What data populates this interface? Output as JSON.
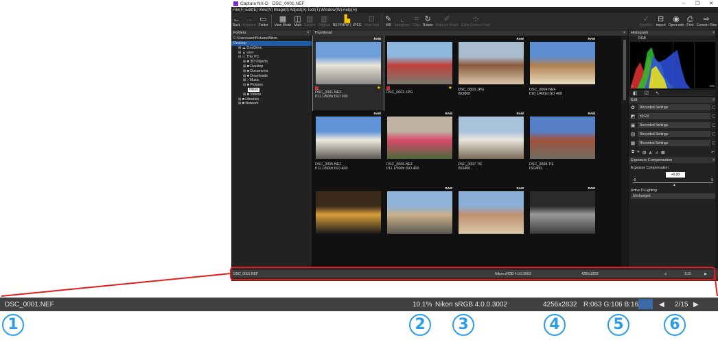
{
  "window": {
    "app_name": "Capture NX-D",
    "file_title": "DSC_0001.NEF",
    "controls": [
      "–",
      "❐",
      "✕"
    ]
  },
  "menu": [
    "File(F)",
    "Edit(E)",
    "View(V)",
    "Image(I)",
    "Adjust(A)",
    "Tool(T)",
    "Window(W)",
    "Help(H)"
  ],
  "toolbar": [
    {
      "label": "Back",
      "icon": "←",
      "name": "back"
    },
    {
      "label": "Forward",
      "icon": "→",
      "name": "forward",
      "dim": true
    },
    {
      "label": "Folder",
      "icon": "▭",
      "name": "folder"
    },
    {
      "sep": true
    },
    {
      "label": "View Mode",
      "icon": "▦",
      "name": "view-mode"
    },
    {
      "label": "Multi",
      "icon": "◫",
      "name": "multi"
    },
    {
      "label": "Current",
      "icon": "▥",
      "name": "current",
      "dim": true
    },
    {
      "label": "Original",
      "icon": "▥",
      "name": "original",
      "dim": true
    },
    {
      "label": "NEF/NRW + JPEG",
      "icon": "▙",
      "name": "nef-jpeg",
      "hl": true
    },
    {
      "label": "View Tool",
      "icon": "⊡",
      "name": "view-tool",
      "dim": true
    },
    {
      "sep": true
    },
    {
      "label": "WB",
      "icon": "✎",
      "name": "wb"
    },
    {
      "label": "Straighten",
      "icon": "⌞",
      "name": "straighten",
      "dim": true
    },
    {
      "label": "Crop",
      "icon": "⌗",
      "name": "crop",
      "dim": true
    },
    {
      "label": "Rotate",
      "icon": "↻",
      "name": "rotate"
    },
    {
      "label": "Retouch Brush",
      "icon": "✐",
      "name": "retouch-brush",
      "dim": true
    },
    {
      "label": "Color Control Point",
      "icon": "⊹",
      "name": "color-control-point",
      "dim": true
    },
    {
      "spacer": true
    },
    {
      "label": "ViewNX-i",
      "icon": "✓",
      "name": "viewnx-i",
      "dim": true
    },
    {
      "label": "Import",
      "icon": "⊟",
      "name": "import"
    },
    {
      "label": "Open with",
      "icon": "◉",
      "name": "open-with"
    },
    {
      "label": "Print",
      "icon": "⎙",
      "name": "print"
    },
    {
      "label": "Convert Files",
      "icon": "⇨",
      "name": "convert-files"
    }
  ],
  "folders": {
    "header": "Folders",
    "path": "C:\\Users\\user\\Pictures\\Nikon",
    "tree": [
      {
        "label": "Desktop",
        "indent": 0,
        "sel": true
      },
      {
        "label": "⊞ ☁ OneDrive",
        "indent": 1
      },
      {
        "label": "⊞ ▲ user",
        "indent": 1
      },
      {
        "label": "⊟ ▭ This PC",
        "indent": 1
      },
      {
        "label": "⊞ ■ 3D Objects",
        "indent": 2
      },
      {
        "label": "⊞ ■ Desktop",
        "indent": 2
      },
      {
        "label": "⊞ ■ Documents",
        "indent": 2
      },
      {
        "label": "⊞ ■ Downloads",
        "indent": 2
      },
      {
        "label": "⊞ ♪ Music",
        "indent": 2
      },
      {
        "label": "⊟ ■ Pictures",
        "indent": 2
      },
      {
        "label": "Nikon",
        "indent": 3,
        "nk": true
      },
      {
        "label": "⊞ ■ Videos",
        "indent": 2
      },
      {
        "label": "⊞ ■ Libraries",
        "indent": 1
      },
      {
        "label": "⊞ ■ Network",
        "indent": 1
      }
    ]
  },
  "thumbnails": {
    "header": "Thumbnail",
    "items": [
      {
        "line1": "DSC_0001.NEF",
        "line2": "f/11 1/500s ISO 200",
        "raw": true,
        "flag": true,
        "star": true,
        "sel": true,
        "colors": [
          "#6f9fd8",
          "#e8e3d8",
          "#8a8a86"
        ]
      },
      {
        "line1": "DSC_0002.JPG",
        "line2": "",
        "flag": true,
        "star": true,
        "colors": [
          "#8fb6dc",
          "#c0403a",
          "#7a7a70"
        ]
      },
      {
        "line1": "DSC_0003.JPG",
        "line2": "ISO800",
        "raw": true,
        "colors": [
          "#a9bccd",
          "#8a5a3e",
          "#d9c9a9"
        ]
      },
      {
        "line1": "DSC_0004.NEF",
        "line2": "f/10 1/400s ISO 400",
        "raw": true,
        "colors": [
          "#5d8fd0",
          "#b08050",
          "#e8dcc0"
        ]
      },
      {
        "line1": "DSC_0005.NEF",
        "line2": "f/11 1/500s ISO 400",
        "raw": true,
        "colors": [
          "#5f93d8",
          "#efe9dc",
          "#5a5a55"
        ]
      },
      {
        "line1": "DSC_0006.NEF",
        "line2": "f/11 1/500s ISO 400",
        "raw": true,
        "colors": [
          "#bfb3a3",
          "#d94a6a",
          "#4a6a3a"
        ]
      },
      {
        "line1": "DSC_0007.TIF",
        "line2": "ISO400",
        "raw": true,
        "colors": [
          "#a9c3dd",
          "#e9e5dd",
          "#7a6a55"
        ]
      },
      {
        "line1": "DSC_0008.TIF",
        "line2": "ISO400",
        "raw": true,
        "colors": [
          "#5580c8",
          "#a0523a",
          "#6d6d62"
        ]
      },
      {
        "line1": "",
        "line2": "",
        "colors": [
          "#3a2a1a",
          "#d9a03a",
          "#1a1a1a"
        ]
      },
      {
        "line1": "",
        "line2": "",
        "raw": true,
        "colors": [
          "#8fb2d8",
          "#c9b08a",
          "#5a5a52"
        ]
      },
      {
        "line1": "",
        "line2": "",
        "raw": true,
        "colors": [
          "#8ab0d8",
          "#c09070",
          "#d8c8a8"
        ]
      },
      {
        "line1": "",
        "line2": "",
        "raw": true,
        "colors": [
          "#2a2a2a",
          "#9a9a9a",
          "#3a3a3a"
        ]
      }
    ]
  },
  "histogram": {
    "header": "Histogram",
    "channel": "RGB",
    "min_label": "0",
    "max_label": "255"
  },
  "edit": {
    "header": "Edit",
    "rows": [
      {
        "icon": "✿",
        "value": "Recorded Settings"
      },
      {
        "icon": "◩",
        "value": "±0 EV"
      },
      {
        "icon": "▣",
        "value": "Recorded Settings"
      },
      {
        "icon": "▤",
        "value": "Recorded Settings"
      },
      {
        "icon": "▦",
        "value": "Recorded Settings"
      }
    ]
  },
  "exposure": {
    "header": "Exposure Compensation",
    "label": "Exposure Compensation",
    "value": "+0.00",
    "min": "-5",
    "max": "5",
    "adl_label": "Active D-Lighting",
    "adl_value": "Unchanged"
  },
  "status_small": {
    "file": "DSC_0001.NEF",
    "profile": "Nikon sRGB 4.0.0.3002",
    "size": "4256x2832",
    "page": "1/15"
  },
  "status_big": {
    "file": "DSC_0001.NEF",
    "zoom": "10.1%",
    "profile": "Nikon sRGB 4.0.0.3002",
    "size": "4256x2832",
    "rgb": "R:063 G:106 B:163",
    "page": "2/15",
    "prev": "◀",
    "next": "▶"
  },
  "callouts": [
    "1",
    "2",
    "3",
    "4",
    "5",
    "6"
  ],
  "colors": {
    "accent": "#e41b1b",
    "callout": "#2a9de6",
    "swatch": "#3a6aa8"
  }
}
